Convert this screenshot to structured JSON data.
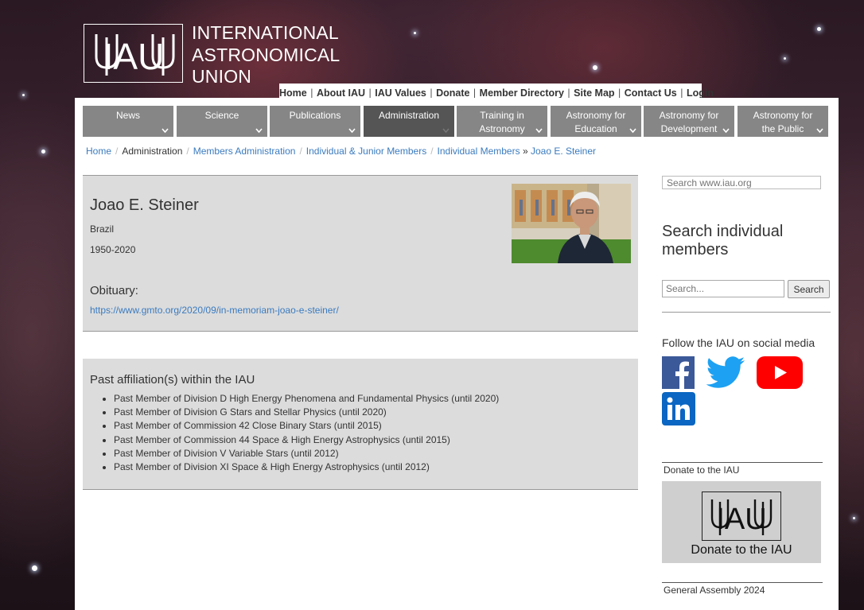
{
  "header": {
    "org_name_lines": [
      "INTERNATIONAL",
      "ASTRONOMICAL",
      "UNION"
    ],
    "logo_text": "IAU"
  },
  "topnav": [
    "Home",
    "About IAU",
    "IAU Values",
    "Donate",
    "Member Directory",
    "Site Map",
    "Contact Us",
    "Login"
  ],
  "menu": [
    {
      "label": "News",
      "active": false
    },
    {
      "label": "Science",
      "active": false
    },
    {
      "label": "Publications",
      "active": false
    },
    {
      "label": "Administration",
      "active": true
    },
    {
      "label": "Training in Astronomy",
      "active": false
    },
    {
      "label": "Astronomy for Education",
      "active": false
    },
    {
      "label": "Astronomy for Development",
      "active": false
    },
    {
      "label": "Astronomy for the Public",
      "active": false
    }
  ],
  "breadcrumb": {
    "home": "Home",
    "administration": "Administration",
    "members_admin": "Members Administration",
    "individual_junior": "Individual & Junior Members",
    "individual": "Individual Members",
    "arrow": "»",
    "current": "Joao E. Steiner"
  },
  "person": {
    "name": "Joao E. Steiner",
    "country": "Brazil",
    "years": "1950-2020",
    "obituary_label": "Obituary:",
    "obituary_url": "https://www.gmto.org/2020/09/in-memoriam-joao-e-steiner/"
  },
  "affiliations": {
    "title": "Past affiliation(s) within the IAU",
    "items": [
      "Past Member of Division D High Energy Phenomena and Fundamental Physics (until 2020)",
      "Past Member of Division G Stars and Stellar Physics (until 2020)",
      "Past Member of Commission 42 Close Binary Stars (until 2015)",
      "Past Member of Commission 44 Space & High Energy Astrophysics (until 2015)",
      "Past Member of Division V Variable Stars (until 2012)",
      "Past Member of Division XI Space & High Energy Astrophysics (until 2012)"
    ]
  },
  "sidebar": {
    "site_search_placeholder": "Search www.iau.org",
    "search_members_heading": "Search individual members",
    "member_search_placeholder": "Search...",
    "member_search_button": "Search",
    "social_title": "Follow the IAU on social media",
    "social_icons": [
      "facebook-icon",
      "twitter-icon",
      "youtube-icon",
      "linkedin-icon"
    ],
    "donate_title": "Donate to the IAU",
    "donate_caption": "Donate to the IAU",
    "ga_title": "General Assembly 2024"
  },
  "colors": {
    "link": "#3b7bbf",
    "menu_bg": "#868686",
    "menu_active_bg": "#555555",
    "card_bg": "#dcdcdc",
    "facebook": "#3b5998",
    "twitter": "#1da1f2",
    "youtube": "#ff0000",
    "linkedin": "#0a66c2"
  }
}
